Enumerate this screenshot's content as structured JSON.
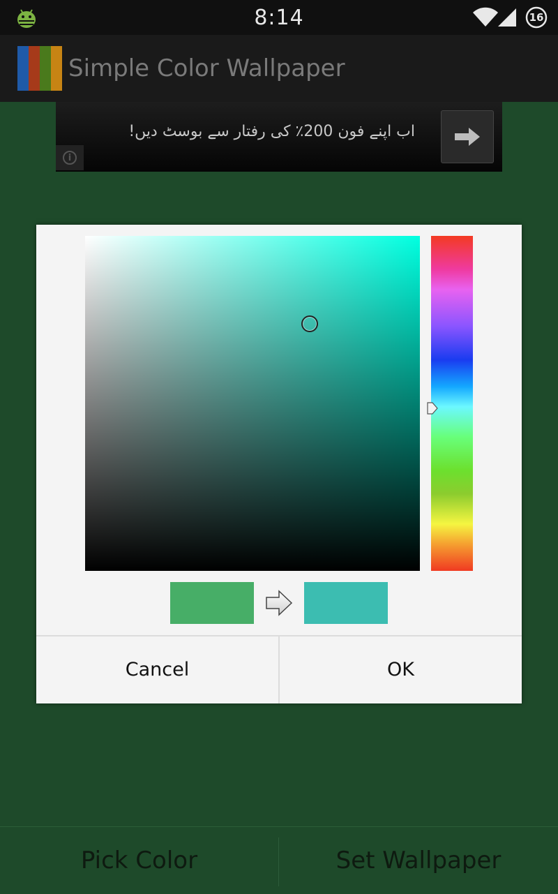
{
  "status_bar": {
    "time": "8:14",
    "battery_level": "16",
    "icons": [
      "android-debug-icon",
      "wifi-icon",
      "signal-icon",
      "battery-icon"
    ]
  },
  "action_bar": {
    "title": "Simple Color Wallpaper",
    "icon_colors": [
      "#1f5aa8",
      "#a63a1a",
      "#4a7a1c",
      "#c78414"
    ]
  },
  "ad": {
    "text": "اب اپنے فون 200٪ کی رفتار سے بوسٹ دیں!",
    "info_label": "i"
  },
  "dialog": {
    "picker_hue_color": "#00ffe0",
    "old_color": "#47ae67",
    "new_color": "#3cbdb1",
    "cancel_label": "Cancel",
    "ok_label": "OK"
  },
  "bottom": {
    "pick_label": "Pick Color",
    "set_label": "Set Wallpaper"
  },
  "colors": {
    "background": "#1e4a2a",
    "status_bar": "#101010",
    "action_bar": "#1a1a1a",
    "dialog": "#f4f4f4"
  }
}
